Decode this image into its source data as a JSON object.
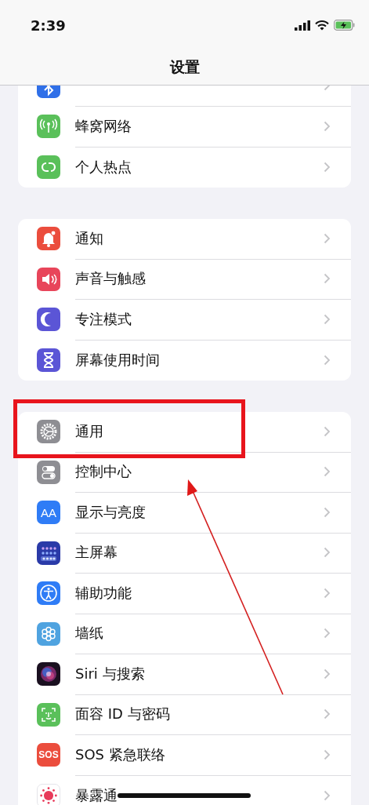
{
  "status_bar": {
    "time": "2:39"
  },
  "navigation": {
    "title": "设置"
  },
  "groups": [
    {
      "rows": [
        {
          "kind": "bluetooth"
        },
        {
          "kind": "cellular",
          "label": "蜂窝网络"
        },
        {
          "kind": "hotspot",
          "label": "个人热点"
        }
      ]
    },
    {
      "rows": [
        {
          "kind": "notifications",
          "label": "通知"
        },
        {
          "kind": "sounds",
          "label": "声音与触感"
        },
        {
          "kind": "focus",
          "label": "专注模式"
        },
        {
          "kind": "screentime",
          "label": "屏幕使用时间"
        }
      ]
    },
    {
      "rows": [
        {
          "kind": "general",
          "label": "通用"
        },
        {
          "kind": "control",
          "label": "控制中心"
        },
        {
          "kind": "display",
          "label": "显示与亮度",
          "icon_text": "AA"
        },
        {
          "kind": "homescreen",
          "label": "主屏幕"
        },
        {
          "kind": "accessibility",
          "label": "辅助功能"
        },
        {
          "kind": "wallpaper",
          "label": "墙纸"
        },
        {
          "kind": "siri",
          "label": "Siri 与搜索"
        },
        {
          "kind": "faceid",
          "label": "面容 ID 与密码"
        },
        {
          "kind": "sos",
          "label": "SOS 紧急联络",
          "icon_text": "SOS"
        },
        {
          "kind": "exposure",
          "label": "暴露通"
        }
      ]
    }
  ]
}
